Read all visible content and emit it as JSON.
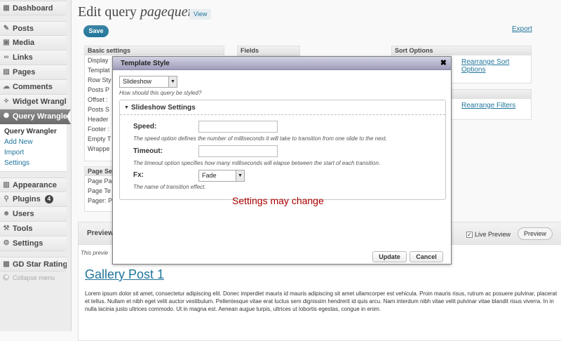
{
  "sidebar": {
    "top_items": [
      {
        "label": "Dashboard",
        "icon": "dashboard-icon"
      }
    ],
    "content_items": [
      {
        "label": "Posts",
        "icon": "posts-icon"
      },
      {
        "label": "Media",
        "icon": "media-icon"
      },
      {
        "label": "Links",
        "icon": "links-icon"
      },
      {
        "label": "Pages",
        "icon": "pages-icon"
      },
      {
        "label": "Comments",
        "icon": "comments-icon"
      },
      {
        "label": "Widget Wrangler",
        "icon": "widget-wrangler-icon"
      },
      {
        "label": "Query Wrangler",
        "icon": "query-wrangler-icon"
      }
    ],
    "submenu": [
      "Query Wrangler",
      "Add New",
      "Import",
      "Settings"
    ],
    "admin_items": [
      {
        "label": "Appearance",
        "icon": "appearance-icon"
      },
      {
        "label": "Plugins",
        "icon": "plugins-icon",
        "badge": "4"
      },
      {
        "label": "Users",
        "icon": "users-icon"
      },
      {
        "label": "Tools",
        "icon": "tools-icon"
      },
      {
        "label": "Settings",
        "icon": "settings-icon"
      }
    ],
    "extra_items": [
      {
        "label": "GD Star Rating",
        "icon": "star-rating-icon"
      }
    ],
    "collapse_label": "Collapse menu"
  },
  "header": {
    "title_prefix": "Edit query",
    "query_name": "pagequery",
    "view_label": "View",
    "save_label": "Save",
    "export_label": "Export"
  },
  "panels": {
    "basic": {
      "title": "Basic settings",
      "rows": [
        "Display",
        "Templat",
        "Row Sty",
        "Posts P",
        "Offset :",
        "Posts S",
        "Header",
        "Footer :",
        "Empty T",
        "Wrappe"
      ]
    },
    "fields": {
      "title": "Fields"
    },
    "sort": {
      "title": "Sort Options",
      "link": "Rearrange Sort Options"
    },
    "filters": {
      "link": "Rearrange Filters"
    },
    "page_settings": {
      "title": "Page Se",
      "rows": [
        "Page Pa",
        "Page Te",
        "Pager: P"
      ]
    }
  },
  "preview": {
    "title": "Preview",
    "live_preview_label": "Live Preview",
    "live_preview_checked": true,
    "button_label": "Preview",
    "hint": "This previe",
    "post_title": "Gallery Post 1",
    "post_body": "Lorem ipsum dolor sit amet, consectetur adipiscing elit. Donec imperdiet mauris id mauris adipiscing sit amet ullamcorper est vehicula. Proin mauris risus, rutrum ac posuere pulvinar, placerat et tellus. Nullam et nibh eget velit auctor vestibulum. Pellentesque vitae erat luctus sem dignissim hendrerit id quis arcu. Nam interdum nibh vitae velit pulvinar vitae blandit risus viverra. In in nulla lacinia justo ultrices commodo. Ut in magna est. Aenean augue turpis, ultrices ut lobortis egestas, congue in enim."
  },
  "dialog": {
    "title": "Template Style",
    "close_glyph": "✖",
    "style_select": "Slideshow",
    "style_help": "How should this query be styled?",
    "group_title": "Slideshow Settings",
    "speed_label": "Speed:",
    "speed_value": "",
    "speed_help": "The speed option defines the number of milliseconds it will take to transition from one slide to the next.",
    "timeout_label": "Timeout:",
    "timeout_value": "",
    "timeout_help": "The timeout option specifies how many milliseconds will elapse between the start of each transition.",
    "fx_label": "Fx:",
    "fx_select": "Fade",
    "fx_help": "The name of transition effect.",
    "note": "Settings may change",
    "update_label": "Update",
    "cancel_label": "Cancel"
  },
  "colors": {
    "link": "#21759b",
    "save_button": "#21759b",
    "note": "#aa0000",
    "dialog_title_bg": "#9c9cbb"
  }
}
